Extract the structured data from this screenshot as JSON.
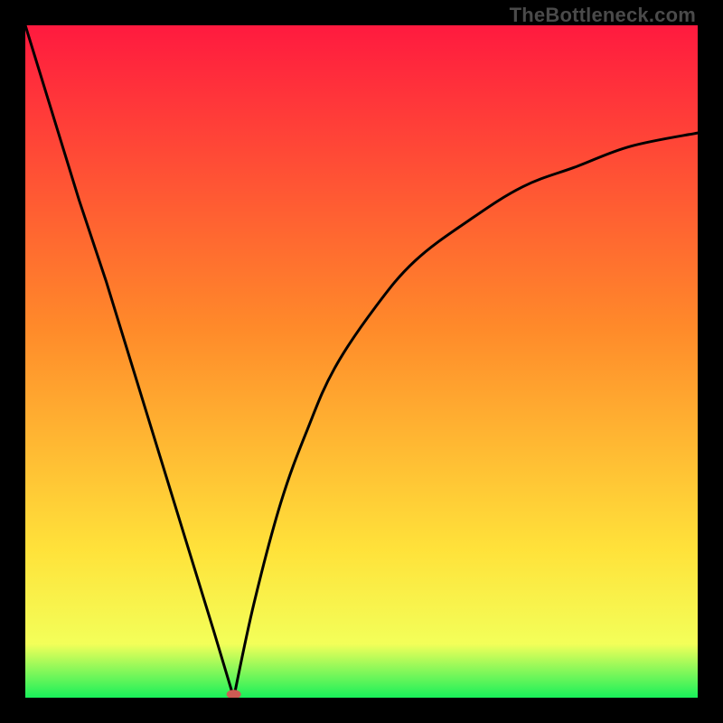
{
  "watermark": "TheBottleneck.com",
  "chart_data": {
    "type": "line",
    "title": "",
    "xlabel": "",
    "ylabel": "",
    "xlim": [
      0,
      1
    ],
    "ylim": [
      0,
      1
    ],
    "background_gradient": {
      "top": "#ff1a3f",
      "mid1": "#ff8a2a",
      "mid2": "#ffe23a",
      "bottom": "#18f05a"
    },
    "curve_notch_x": 0.31,
    "series": [
      {
        "name": "left-branch",
        "x": [
          0.0,
          0.04,
          0.08,
          0.12,
          0.16,
          0.2,
          0.24,
          0.28,
          0.31
        ],
        "y": [
          1.0,
          0.87,
          0.74,
          0.62,
          0.49,
          0.36,
          0.23,
          0.1,
          0.0
        ]
      },
      {
        "name": "right-branch",
        "x": [
          0.31,
          0.34,
          0.38,
          0.42,
          0.46,
          0.52,
          0.58,
          0.66,
          0.74,
          0.82,
          0.9,
          1.0
        ],
        "y": [
          0.0,
          0.14,
          0.29,
          0.4,
          0.49,
          0.58,
          0.65,
          0.71,
          0.76,
          0.79,
          0.82,
          0.84
        ]
      }
    ],
    "marker": {
      "x": 0.31,
      "y": 0.005,
      "color": "#cd5c54",
      "rx": 8,
      "ry": 5
    }
  }
}
